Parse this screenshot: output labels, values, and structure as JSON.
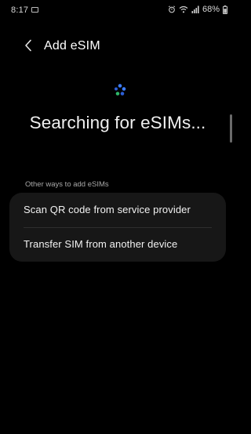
{
  "status_bar": {
    "time": "8:17",
    "battery": "68%"
  },
  "header": {
    "title": "Add eSIM"
  },
  "main": {
    "searching_text": "Searching for eSIMs...",
    "section_label": "Other ways to add eSIMs",
    "options": [
      {
        "label": "Scan QR code from service provider"
      },
      {
        "label": "Transfer SIM from another device"
      }
    ]
  },
  "icons": {
    "back": "chevron-left-icon",
    "spinner": "loading-spinner-icon",
    "alarm": "alarm-icon",
    "wifi": "wifi-icon",
    "signal": "signal-icon",
    "screenshot": "screenshot-icon"
  },
  "colors": {
    "background": "#000000",
    "card": "#171717",
    "spinner_blue": "#3d7dff",
    "spinner_green": "#2fb86a"
  }
}
